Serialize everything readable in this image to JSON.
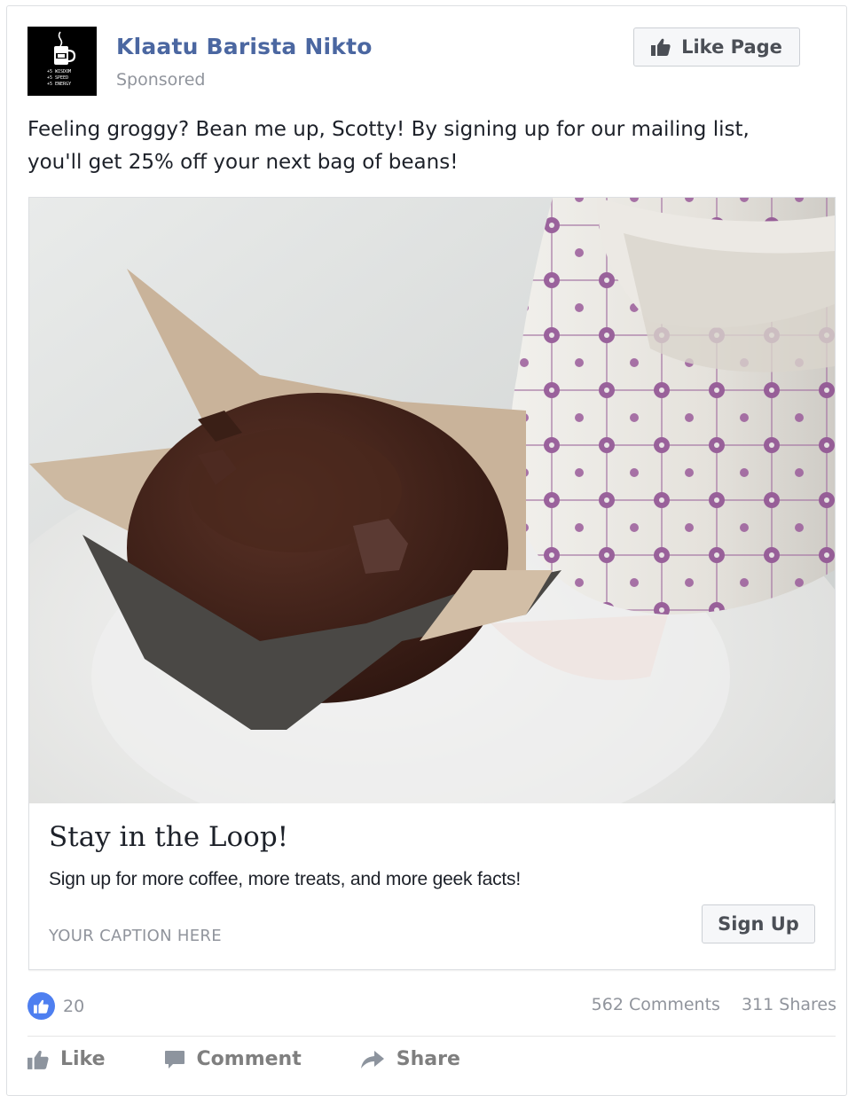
{
  "post": {
    "page_name": "Klaatu Barista Nikto",
    "sponsored_label": "Sponsored",
    "like_page_label": "Like Page",
    "text_line1": "Feeling groggy? Bean me up, Scotty! By signing up for our mailing list,",
    "text_line2": "you'll get 25% off your next bag of beans!"
  },
  "avatar": {
    "logo_text": [
      "+5 WISDOM",
      "+5 SPEED",
      "+5 ENERGY"
    ]
  },
  "ad": {
    "image_description_icon": "muffin-and-teacup-photo",
    "headline": "Stay in the Loop!",
    "description": "Sign up for more coffee, more treats, and more geek facts!",
    "caption": "YOUR CAPTION HERE",
    "cta_label": "Sign Up"
  },
  "engagement": {
    "like_count": "20",
    "comments": "562 Comments",
    "shares": "311 Shares"
  },
  "actions": {
    "like": "Like",
    "comment": "Comment",
    "share": "Share"
  },
  "colors": {
    "page_name": "#4b67a1",
    "like_bubble": "#4e7ff0",
    "muted": "#90949c"
  }
}
